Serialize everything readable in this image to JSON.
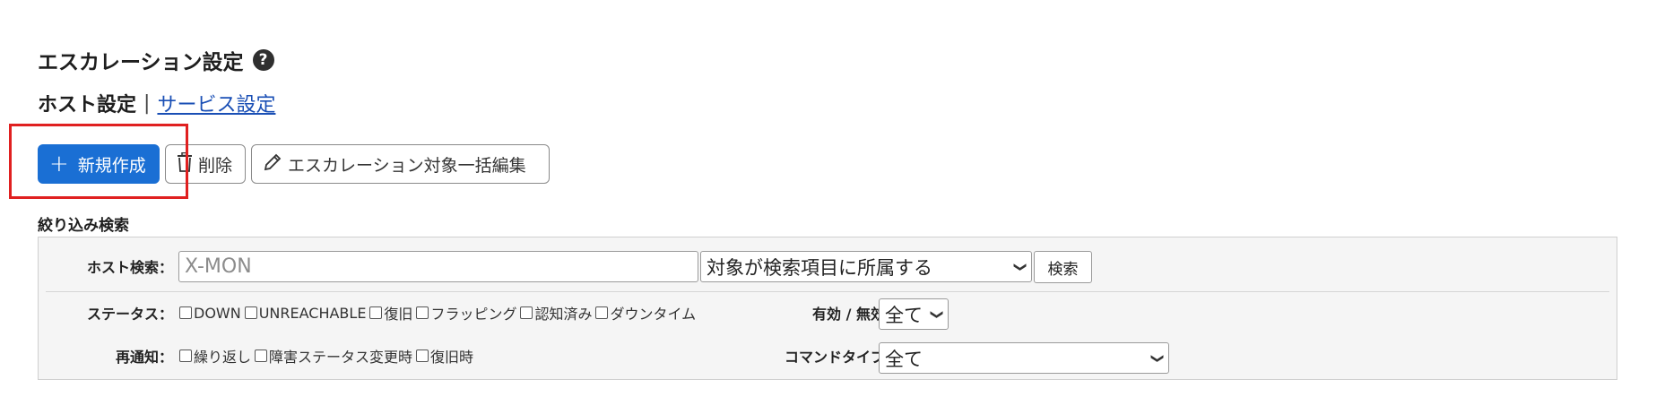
{
  "page_title": "エスカレーション設定",
  "subnav": {
    "current": "ホスト設定",
    "separator": "|",
    "link": "サービス設定"
  },
  "toolbar": {
    "new_label": "新規作成",
    "delete_label": "削除",
    "bulk_edit_label": "エスカレーション対象一括編集"
  },
  "filter": {
    "section_label": "絞り込み検索",
    "host_search_label": "ホスト検索：",
    "host_search_placeholder": "X-MON",
    "match_select_value": "対象が検索項目に所属する",
    "search_button": "検索",
    "status_label": "ステータス：",
    "status_options": [
      "DOWN",
      "UNREACHABLE",
      "復旧",
      "フラッピング",
      "認知済み",
      "ダウンタイム"
    ],
    "enabled_label": "有効 / 無効：",
    "enabled_value": "全て",
    "renotify_label": "再通知：",
    "renotify_options": [
      "繰り返し",
      "障害ステータス変更時",
      "復旧時"
    ],
    "command_type_label": "コマンドタイプ：",
    "command_type_value": "全て"
  },
  "colors": {
    "primary": "#1a6fd4",
    "link": "#1a4fb5",
    "highlight": "#e02020"
  },
  "icons": [
    "help-icon",
    "plus-icon",
    "trash-icon",
    "pencil-icon",
    "chevron-down-icon"
  ]
}
